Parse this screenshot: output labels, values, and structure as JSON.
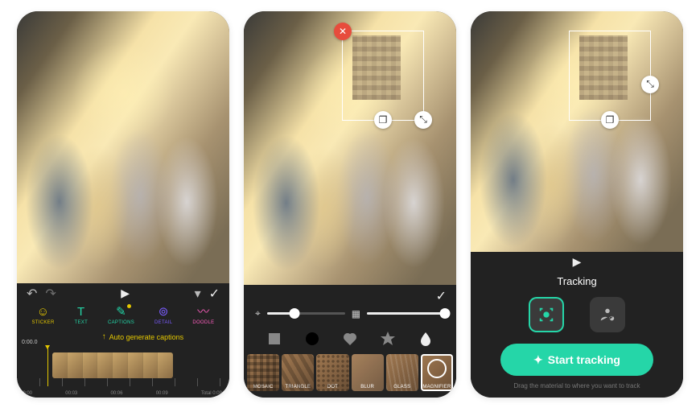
{
  "screen1": {
    "cursor_time": "0:00.0",
    "tools": {
      "sticker": {
        "label": "STICKER",
        "glyph": "☺"
      },
      "text": {
        "label": "TEXT",
        "glyph": "T"
      },
      "caption": {
        "label": "CAPTIONS",
        "glyph": "✎"
      },
      "detail": {
        "label": "DETAIL",
        "glyph": "⊚"
      },
      "doodle": {
        "label": "DOODLE",
        "glyph": "〰"
      }
    },
    "callout": "Auto generate captions",
    "timeline_labels": {
      "t0": "00:00",
      "t1": "00:03",
      "t2": "00:06",
      "t3": "00:09",
      "total": "Total 0:09.2"
    }
  },
  "screen2": {
    "slider_size_pct": 35,
    "slider_intensity_pct": 100,
    "styles": {
      "mosaic": "MOSAIC",
      "triangle": "TRIANGLE",
      "dot": "DOT",
      "blur": "BLUR",
      "glass": "GLASS",
      "magnifier": "MAGNIFIER"
    }
  },
  "screen3": {
    "title": "Tracking",
    "start_label": "Start tracking",
    "hint": "Drag the material to where you want to track"
  }
}
